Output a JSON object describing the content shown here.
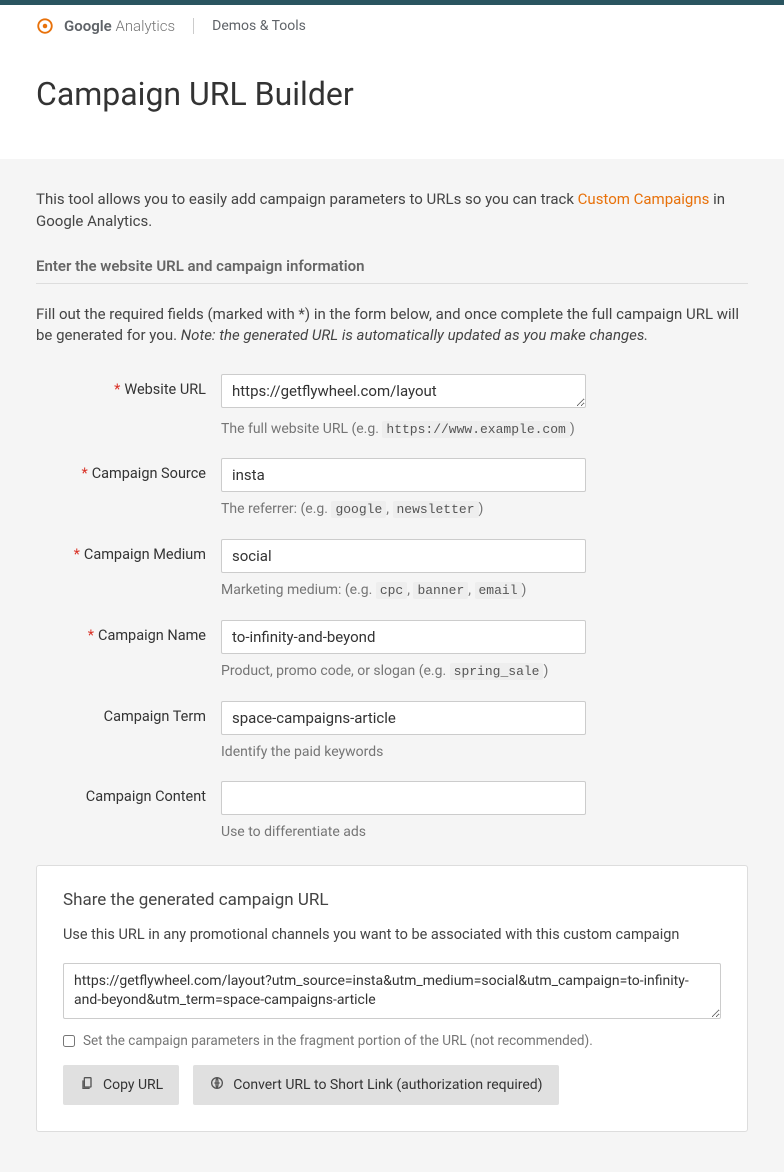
{
  "header": {
    "brand_strong": "Google",
    "brand_thin": "Analytics",
    "subbrand": "Demos & Tools"
  },
  "page_title": "Campaign URL Builder",
  "intro": {
    "before": "This tool allows you to easily add campaign parameters to URLs so you can track ",
    "link": "Custom Campaigns",
    "after": " in Google Analytics."
  },
  "section_heading": "Enter the website URL and campaign information",
  "instructions": {
    "plain": "Fill out the required fields (marked with *) in the form below, and once complete the full campaign URL will be generated for you. ",
    "italic": "Note: the generated URL is automatically updated as you make changes."
  },
  "fields": {
    "website_url": {
      "label": "Website URL",
      "value": "https://getflywheel.com/layout",
      "hint_before": "The full website URL (e.g. ",
      "hint_code": "https://www.example.com",
      "hint_after": ")",
      "required": true
    },
    "campaign_source": {
      "label": "Campaign Source",
      "value": "insta",
      "hint_before": "The referrer: (e.g. ",
      "hint_code1": "google",
      "hint_sep": ", ",
      "hint_code2": "newsletter",
      "hint_after": ")",
      "required": true
    },
    "campaign_medium": {
      "label": "Campaign Medium",
      "value": "social",
      "hint_before": "Marketing medium: (e.g. ",
      "hint_code1": "cpc",
      "hint_code2": "banner",
      "hint_code3": "email",
      "hint_sep": ", ",
      "hint_after": ")",
      "required": true
    },
    "campaign_name": {
      "label": "Campaign Name",
      "value": "to-infinity-and-beyond",
      "hint_before": "Product, promo code, or slogan (e.g. ",
      "hint_code": "spring_sale",
      "hint_after": ")",
      "required": true
    },
    "campaign_term": {
      "label": "Campaign Term",
      "value": "space-campaigns-article",
      "hint": "Identify the paid keywords",
      "required": false
    },
    "campaign_content": {
      "label": "Campaign Content",
      "value": "",
      "hint": "Use to differentiate ads",
      "required": false
    }
  },
  "output": {
    "title": "Share the generated campaign URL",
    "desc": "Use this URL in any promotional channels you want to be associated with this custom campaign",
    "url": "https://getflywheel.com/layout?utm_source=insta&utm_medium=social&utm_campaign=to-infinity-and-beyond&utm_term=space-campaigns-article",
    "checkbox_label": "Set the campaign parameters in the fragment portion of the URL (not recommended).",
    "copy_btn": "Copy URL",
    "convert_btn": "Convert URL to Short Link (authorization required)"
  }
}
